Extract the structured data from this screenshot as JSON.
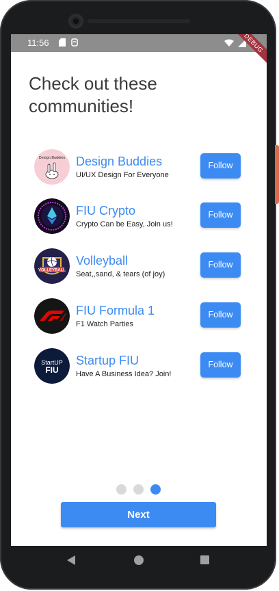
{
  "status_bar": {
    "time": "11:56",
    "debug_label": "DEBUG"
  },
  "heading": "Check out these communities!",
  "communities": [
    {
      "name": "Design Buddies",
      "tagline": "UI/UX Design For Everyone",
      "follow_label": "Follow",
      "avatar_text": "Design Buddies"
    },
    {
      "name": "FIU Crypto",
      "tagline": "Crypto Can be Easy, Join us!",
      "follow_label": "Follow",
      "avatar_text": ""
    },
    {
      "name": "Volleyball",
      "tagline": "Seat,,sand, & tears (of joy)",
      "follow_label": "Follow",
      "avatar_text": "VOLLEYBALL"
    },
    {
      "name": "FIU Formula 1",
      "tagline": "F1 Watch Parties",
      "follow_label": "Follow",
      "avatar_text": ""
    },
    {
      "name": "Startup FIU",
      "tagline": "Have A Business Idea? Join!",
      "follow_label": "Follow",
      "avatar_text": "StartUP FIU"
    }
  ],
  "page_indicator": {
    "total": 3,
    "current": 3
  },
  "next_label": "Next",
  "colors": {
    "accent": "#3c8bf3",
    "dot_inactive": "#d9d9d9",
    "status_bar": "#8d8d8d"
  }
}
